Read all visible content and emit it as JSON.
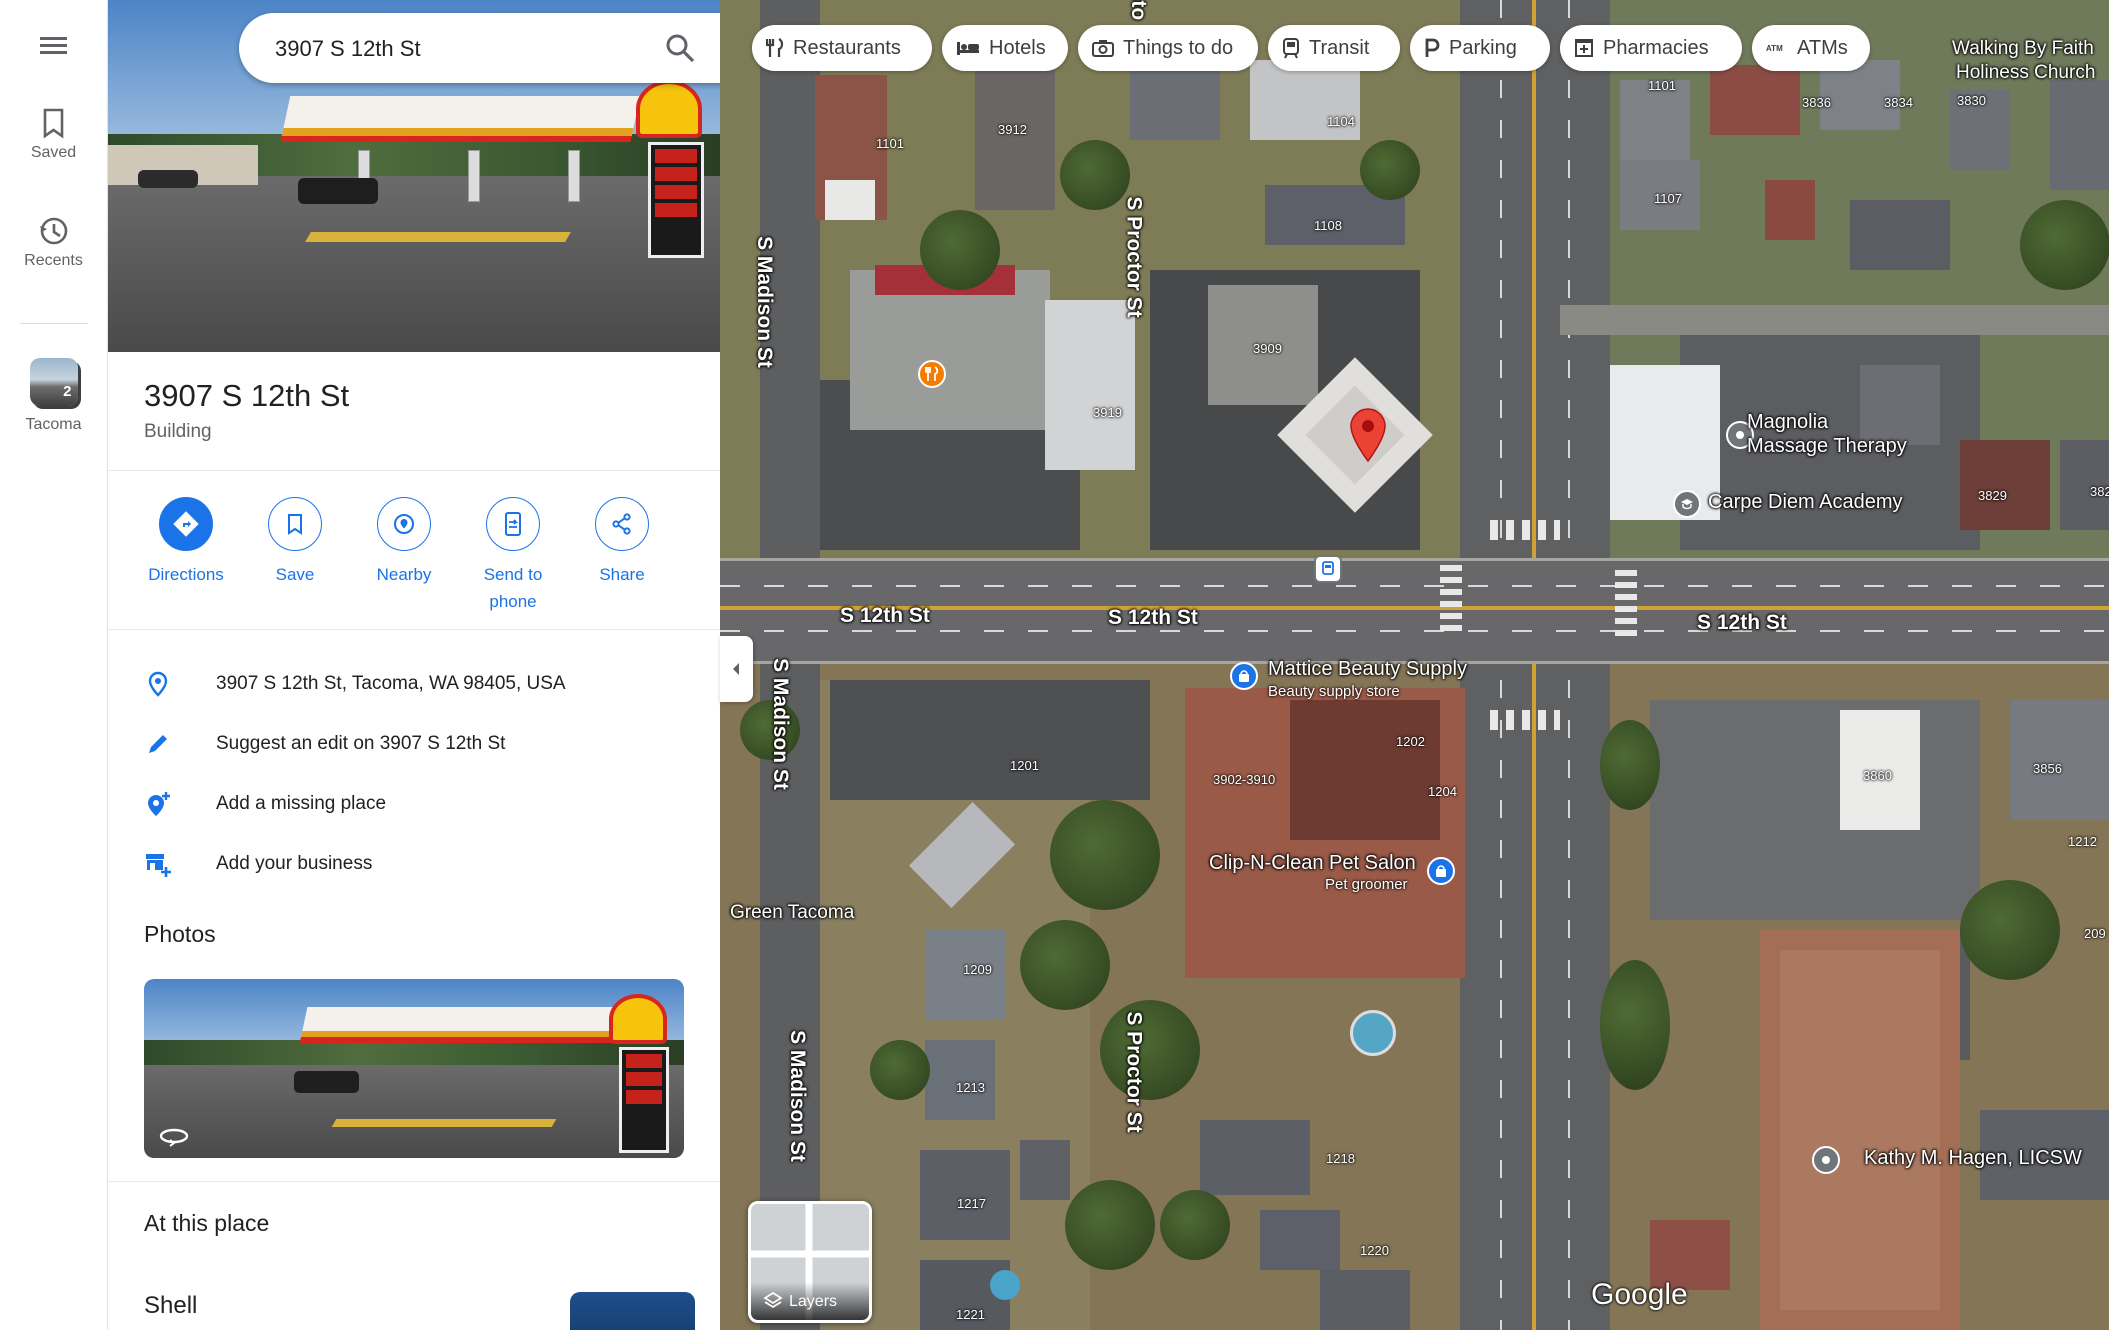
{
  "search": {
    "value": "3907 S 12th St"
  },
  "rail": {
    "saved_label": "Saved",
    "recents_label": "Recents",
    "recent_place": {
      "label": "Tacoma",
      "count": "2"
    }
  },
  "place": {
    "title": "3907 S 12th St",
    "subtitle": "Building"
  },
  "actions": [
    {
      "label": "Directions",
      "icon": "directions-icon"
    },
    {
      "label": "Save",
      "icon": "bookmark-icon"
    },
    {
      "label": "Nearby",
      "icon": "nearby-icon"
    },
    {
      "label": "Send to phone",
      "icon": "send-to-phone-icon"
    },
    {
      "label": "Share",
      "icon": "share-icon"
    }
  ],
  "info_rows": [
    {
      "text": "3907 S 12th St, Tacoma, WA 98405, USA",
      "icon": "location-pin-icon"
    },
    {
      "text": "Suggest an edit on 3907 S 12th St",
      "icon": "pencil-icon"
    },
    {
      "text": "Add a missing place",
      "icon": "add-location-icon"
    },
    {
      "text": "Add your business",
      "icon": "add-business-icon"
    }
  ],
  "photos_title": "Photos",
  "at_this_place": {
    "title": "At this place",
    "first_item": "Shell"
  },
  "chips": [
    {
      "label": "Restaurants",
      "icon": "fork-knife-icon"
    },
    {
      "label": "Hotels",
      "icon": "bed-icon"
    },
    {
      "label": "Things to do",
      "icon": "camera-icon"
    },
    {
      "label": "Transit",
      "icon": "train-icon"
    },
    {
      "label": "Parking",
      "icon": "parking-icon"
    },
    {
      "label": "Pharmacies",
      "icon": "pharmacy-icon"
    },
    {
      "label": "ATMs",
      "icon": "atm-icon"
    }
  ],
  "map": {
    "streets": {
      "s12_a": "S 12th St",
      "s12_b": "S 12th St",
      "s12_c": "S 12th St",
      "madison_a": "S Madison St",
      "madison_b": "S Madison St",
      "madison_c": "S Madison St",
      "proctor_a": "S Proctor St",
      "proctor_b": "S Proctor St",
      "proctor_top": "S Procto"
    },
    "pois": {
      "mattice": {
        "name": "Mattice Beauty Supply",
        "sub": "Beauty supply store"
      },
      "clipnclean": {
        "name": "Clip-N-Clean Pet Salon",
        "sub": "Pet groomer"
      },
      "magnolia_1": "Magnolia",
      "magnolia_2": "Massage Therapy",
      "carpe": "Carpe Diem Academy",
      "kathy": "Kathy M. Hagen, LICSW",
      "walking_1": "Walking By Faith",
      "walking_2": "Holiness Church",
      "green": "Green Tacoma"
    },
    "house_numbers": {
      "n1101a": "1101",
      "n3912": "3912",
      "n1104": "1104",
      "n1108": "1108",
      "n3909": "3909",
      "n3919": "3919",
      "n1101b": "1101",
      "n3836": "3836",
      "n3834": "3834",
      "n3830": "3830",
      "n1107": "1107",
      "n3829": "3829",
      "n382x": "382",
      "n1201": "1201",
      "n1202": "1202",
      "n1204": "1204",
      "n3902": "3902-3910",
      "n1209": "1209",
      "n1213": "1213",
      "n1217": "1217",
      "n1218": "1218",
      "n1220": "1220",
      "n1221": "1221",
      "n3860": "3860",
      "n3856": "3856",
      "n1212": "1212",
      "n209": "209"
    },
    "layers_label": "Layers",
    "logo": "Google"
  },
  "colors": {
    "accent": "#1a73e8",
    "pin": "#ea4335",
    "poi_blue": "#1a73e8",
    "poi_gray": "#70757a",
    "restaurant": "#f57c00"
  }
}
